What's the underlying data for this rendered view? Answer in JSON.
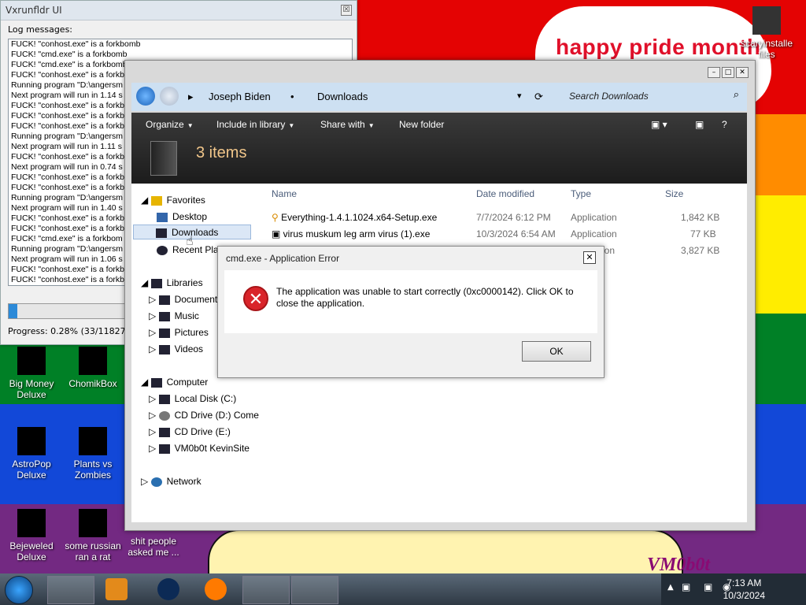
{
  "wallpaper": {
    "banner": "happy pride month",
    "watermark": "VM0b0t",
    "stripe_colors": [
      "#e40303",
      "#ff8c00",
      "#ffed00",
      "#008026",
      "#1248d8",
      "#732982"
    ]
  },
  "desktop_icons": [
    {
      "label_1": "Big Money",
      "label_2": "Deluxe"
    },
    {
      "label_1": "ChomikBox",
      "label_2": ""
    },
    {
      "label_1": "AstroPop",
      "label_2": "Deluxe"
    },
    {
      "label_1": "Plants vs",
      "label_2": "Zombies"
    },
    {
      "label_1": "Bejeweled",
      "label_2": "Deluxe"
    },
    {
      "label_1": "some russian",
      "label_2": "ran a rat"
    },
    {
      "label_1": "shit people",
      "label_2": "asked me ..."
    },
    {
      "label_1": "scaryinstalle",
      "label_2": "files"
    }
  ],
  "log_window": {
    "title": "Vxrunfldr UI",
    "close": "☒",
    "label": "Log messages:",
    "lines": [
      "FUCK! \"conhost.exe\" is a forkbomb",
      "FUCK! \"cmd.exe\" is a forkbomb",
      "FUCK! \"cmd.exe\" is a forkbomb",
      "FUCK! \"conhost.exe\" is a forkbomb",
      "Running program \"D:\\angersm",
      "Next program will run in 1.14 s",
      "FUCK! \"conhost.exe\" is a forkb",
      "FUCK! \"conhost.exe\" is a forkb",
      "FUCK! \"conhost.exe\" is a forkb",
      "Running program \"D:\\angersm",
      "Next program will run in 1.11 s",
      "FUCK! \"conhost.exe\" is a forkb",
      "Next program will run in 0.74 s",
      "FUCK! \"conhost.exe\" is a forkb",
      "FUCK! \"conhost.exe\" is a forkb",
      "Running program \"D:\\angersm",
      "Next program will run in 1.40 s",
      "FUCK! \"conhost.exe\" is a forkb",
      "FUCK! \"conhost.exe\" is a forkb",
      "FUCK! \"cmd.exe\" is a forkbom",
      "Running program \"D:\\angersm",
      "Next program will run in 1.06 s",
      "FUCK! \"conhost.exe\" is a forkb",
      "FUCK! \"conhost.exe\" is a forkb"
    ],
    "progress_fraction": 0.0028,
    "progress_text": "Progress: 0.28% (33/11827 prog"
  },
  "explorer": {
    "breadcrumb": [
      "Joseph Biden",
      "Downloads"
    ],
    "search_placeholder": "Search Downloads",
    "toolbar": {
      "organize": "Organize",
      "include": "Include in library",
      "share": "Share with",
      "new_folder": "New folder"
    },
    "item_count": "3 items",
    "nav": {
      "favorites": "Favorites",
      "desktop": "Desktop",
      "downloads": "Downloads",
      "recent": "Recent Plac",
      "libraries": "Libraries",
      "documents": "Document",
      "music": "Music",
      "pictures": "Pictures",
      "videos": "Videos",
      "computer": "Computer",
      "local_disk": "Local Disk (C:)",
      "cd_d": "CD Drive (D:) Come",
      "cd_e": "CD Drive (E:)",
      "vm": "VM0b0t KevinSite",
      "network": "Network"
    },
    "columns": {
      "name": "Name",
      "date": "Date modified",
      "type": "Type",
      "size": "Size"
    },
    "files": [
      {
        "name": "Everything-1.4.1.1024.x64-Setup.exe",
        "date": "7/7/2024 6:12 PM",
        "type": "Application",
        "size": "1,842 KB"
      },
      {
        "name": "virus muskum leg arm virus (1).exe",
        "date": "10/3/2024 6:54 AM",
        "type": "Application",
        "size": "77 KB"
      },
      {
        "name": "",
        "date": "",
        "type": "ation",
        "size": "3,827 KB"
      }
    ]
  },
  "dialog": {
    "title": "cmd.exe - Application Error",
    "close": "✕",
    "message": "The application was unable to start correctly (0xc0000142). Click OK to close the application.",
    "ok": "OK"
  },
  "taskbar": {
    "time": "7:13 AM",
    "date": "10/3/2024"
  }
}
